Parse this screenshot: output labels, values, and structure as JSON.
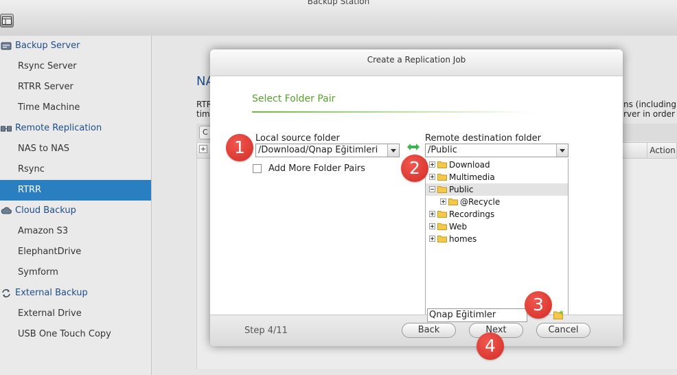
{
  "window": {
    "title": "Backup Station"
  },
  "sidebar": {
    "items": [
      {
        "label": "Backup Server",
        "type": "category",
        "icon": "server-icon"
      },
      {
        "label": "Rsync Server",
        "type": "item"
      },
      {
        "label": "RTRR Server",
        "type": "item"
      },
      {
        "label": "Time Machine",
        "type": "item"
      },
      {
        "label": "Remote Replication",
        "type": "category",
        "icon": "replication-icon"
      },
      {
        "label": "NAS to NAS",
        "type": "item"
      },
      {
        "label": "Rsync",
        "type": "item"
      },
      {
        "label": "RTRR",
        "type": "item",
        "active": true
      },
      {
        "label": "Cloud Backup",
        "type": "category",
        "icon": "cloud-icon"
      },
      {
        "label": "Amazon S3",
        "type": "item"
      },
      {
        "label": "ElephantDrive",
        "type": "item"
      },
      {
        "label": "Symform",
        "type": "item"
      },
      {
        "label": "External Backup",
        "type": "category",
        "icon": "sync-icon"
      },
      {
        "label": "External Drive",
        "type": "item"
      },
      {
        "label": "USB One Touch Copy",
        "type": "item"
      }
    ]
  },
  "background": {
    "title": "NA",
    "text_left_1": "RTR",
    "text_left_2": "tim",
    "text_right_1": "ns (including",
    "text_right_2": "rver in order",
    "toolbar_fragment": "C",
    "table_action_header": "Action"
  },
  "dialog": {
    "title": "Create a Replication Job",
    "section_title": "Select Folder Pair",
    "local_label": "Local source folder",
    "local_value": "/Download/Qnap Eğitimleri",
    "remote_label": "Remote destination folder",
    "remote_value": "/Public",
    "add_more_label": "Add More Folder Pairs",
    "tree": [
      {
        "name": "Download",
        "expander": "plus"
      },
      {
        "name": "Multimedia",
        "expander": "plus"
      },
      {
        "name": "Public",
        "expander": "minus",
        "selected": true
      },
      {
        "name": "@Recycle",
        "expander": "plus",
        "child": true
      },
      {
        "name": "Recordings",
        "expander": "plus"
      },
      {
        "name": "Web",
        "expander": "plus"
      },
      {
        "name": "homes",
        "expander": "plus"
      }
    ],
    "new_folder_value": "Qnap Eğitimler",
    "step": "Step 4/11",
    "back_label": "Back",
    "next_label": "Next",
    "cancel_label": "Cancel"
  },
  "badges": [
    "1",
    "2",
    "3",
    "4"
  ],
  "colors": {
    "accent_blue": "#2a7fc0",
    "category_text": "#1f4d8a",
    "section_green": "#55a32b",
    "badge_red": "#d9342b",
    "folder_yellow": "#f5c84a"
  }
}
